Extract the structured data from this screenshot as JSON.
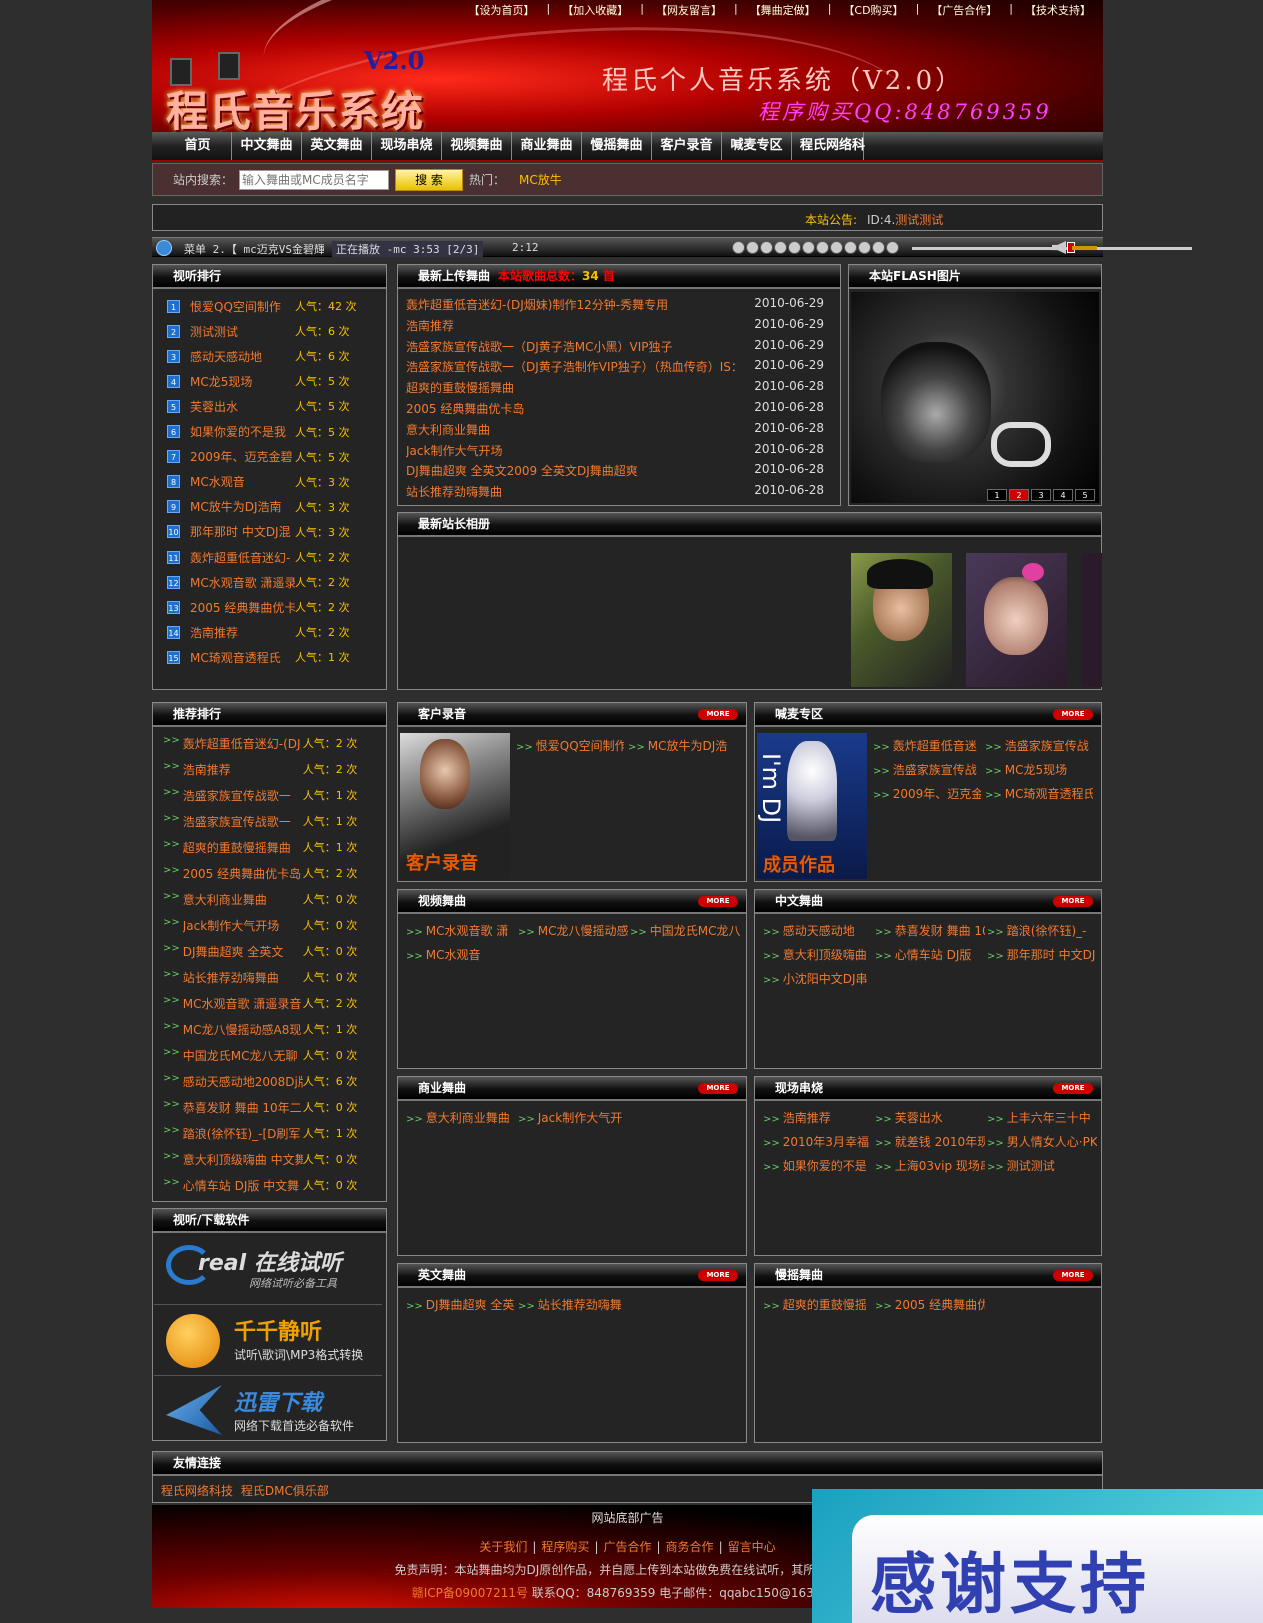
{
  "topbar": [
    "【设为首页】",
    "【加入收藏】",
    "【网友留言】",
    "【舞曲定做】",
    "【CD购买】",
    "【广告合作】",
    "【技术支持】"
  ],
  "header": {
    "logo": "程氏音乐系统",
    "version": "V2.0",
    "slogan": "程氏个人音乐系统（V2.0）",
    "qq": "程序购买QQ:848769359"
  },
  "nav": [
    "首页",
    "中文舞曲",
    "英文舞曲",
    "现场串烧",
    "视频舞曲",
    "商业舞曲",
    "慢摇舞曲",
    "客户录音",
    "喊麦专区",
    "程氏网络科"
  ],
  "search": {
    "label": "站内搜索：",
    "placeholder": "输入舞曲或MC成员名字",
    "button": "搜 索",
    "hot_label": "热门：",
    "hot_value": "MC放牛"
  },
  "notice": {
    "label": "本站公告:",
    "id": "ID:4.",
    "text": "测试测试"
  },
  "player": {
    "menu": "菜单 2.【 mc迈克VS金碧輝",
    "status": "正在播放 -mc 3:53 [2/3]",
    "time": "2:12"
  },
  "listen_rank": {
    "title": "视听排行",
    "items": [
      {
        "num": "1",
        "name": "恨爱QQ空间制作",
        "pop": "人气：42 次"
      },
      {
        "num": "2",
        "name": "测试测试",
        "pop": "人气：6 次"
      },
      {
        "num": "3",
        "name": "感动天感动地",
        "pop": "人气：6 次"
      },
      {
        "num": "4",
        "name": "MC龙5现场",
        "pop": "人气：5 次"
      },
      {
        "num": "5",
        "name": "芙蓉出水",
        "pop": "人气：5 次"
      },
      {
        "num": "6",
        "name": "如果你爱的不是我",
        "pop": "人气：5 次"
      },
      {
        "num": "7",
        "name": "2009年、迈克金碧",
        "pop": "人气：5 次"
      },
      {
        "num": "8",
        "name": "MC水观音",
        "pop": "人气：3 次"
      },
      {
        "num": "9",
        "name": "MC放牛为DJ浩南",
        "pop": "人气：3 次"
      },
      {
        "num": "10",
        "name": "那年那时 中文DJ混",
        "pop": "人气：3 次"
      },
      {
        "num": "11",
        "name": "轰炸超重低音迷幻-",
        "pop": "人气：2 次"
      },
      {
        "num": "12",
        "name": "MC水观音歌 潇遥录",
        "pop": "人气：2 次"
      },
      {
        "num": "13",
        "name": "2005 经典舞曲优卡",
        "pop": "人气：2 次"
      },
      {
        "num": "14",
        "name": "浩南推荐",
        "pop": "人气：2 次"
      },
      {
        "num": "15",
        "name": "MC琦观音透程氏",
        "pop": "人气：1 次"
      }
    ]
  },
  "latest_upload": {
    "title": "最新上传舞曲",
    "total_label": "本站歌曲总数：",
    "total": "34",
    "unit": "首",
    "items": [
      {
        "name": "轰炸超重低音迷幻-(DJ烟妹)制作12分钟-秀舞专用",
        "date": "2010-06-29"
      },
      {
        "name": "浩南推荐",
        "date": "2010-06-29"
      },
      {
        "name": "浩盛家族宣传战歌一（DJ黄子浩MC小黑）VIP独子",
        "date": "2010-06-29"
      },
      {
        "name": "浩盛家族宣传战歌一（DJ黄子浩制作VIP独子）（热血传奇）IS：",
        "date": "2010-06-29"
      },
      {
        "name": "超爽的重鼓慢摇舞曲",
        "date": "2010-06-28"
      },
      {
        "name": "2005 经典舞曲优卡岛",
        "date": "2010-06-28"
      },
      {
        "name": "意大利商业舞曲",
        "date": "2010-06-28"
      },
      {
        "name": "Jack制作大气开场",
        "date": "2010-06-28"
      },
      {
        "name": "DJ舞曲超爽 全英文2009 全英文DJ舞曲超爽",
        "date": "2010-06-28"
      },
      {
        "name": "站长推荐劲嗨舞曲",
        "date": "2010-06-28"
      }
    ]
  },
  "flash": {
    "title": "本站FLASH图片",
    "pages": [
      "1",
      "2",
      "3",
      "4",
      "5"
    ]
  },
  "album": {
    "title": "最新站长相册"
  },
  "recommend": {
    "title": "推荐排行",
    "items": [
      {
        "name": "轰炸超重低音迷幻-(DJ",
        "pop": "人气：2 次"
      },
      {
        "name": "浩南推荐",
        "pop": "人气：2 次"
      },
      {
        "name": "浩盛家族宣传战歌一",
        "pop": "人气：1 次"
      },
      {
        "name": "浩盛家族宣传战歌一",
        "pop": "人气：1 次"
      },
      {
        "name": "超爽的重鼓慢摇舞曲",
        "pop": "人气：1 次"
      },
      {
        "name": "2005 经典舞曲优卡岛",
        "pop": "人气：2 次"
      },
      {
        "name": "意大利商业舞曲",
        "pop": "人气：0 次"
      },
      {
        "name": "Jack制作大气开场",
        "pop": "人气：0 次"
      },
      {
        "name": "DJ舞曲超爽 全英文",
        "pop": "人气：0 次"
      },
      {
        "name": "站长推荐劲嗨舞曲",
        "pop": "人气：0 次"
      },
      {
        "name": "MC水观音歌 潇遥录音",
        "pop": "人气：2 次"
      },
      {
        "name": "MC龙八慢摇动感A8现",
        "pop": "人气：1 次"
      },
      {
        "name": "中国龙氏MC龙八无聊",
        "pop": "人气：0 次"
      },
      {
        "name": "感动天感动地2008Dj版",
        "pop": "人气：6 次"
      },
      {
        "name": "恭喜发财 舞曲 10年二",
        "pop": "人气：0 次"
      },
      {
        "name": "踏浪(徐怀钰)_-[D刷军",
        "pop": "人气：1 次"
      },
      {
        "name": "意大利顶级嗨曲 中文舞",
        "pop": "人气：0 次"
      },
      {
        "name": "心情车站 DJ版 中文舞",
        "pop": "人气：0 次"
      }
    ]
  },
  "software": {
    "title": "视听/下载软件",
    "items": [
      {
        "name": "real 在线试听",
        "sub": "网络试听必备工具"
      },
      {
        "name": "千千静听",
        "sub": "试听\\歌词\\MP3格式转换"
      },
      {
        "name": "迅雷下载",
        "sub": "网络下载首选必备软件"
      }
    ]
  },
  "sections": [
    {
      "title": "客户录音",
      "img": "客户录音",
      "links": [
        "恨爱QQ空间制作",
        "MC放牛为DJ浩"
      ]
    },
    {
      "title": "喊麦专区",
      "img": "成员作品",
      "img_sub": "I'm DJ",
      "links": [
        "轰炸超重低音迷",
        "浩盛家族宣传战",
        "浩盛家族宣传战",
        "MC龙5现场",
        "2009年、迈克金",
        "MC琦观音透程氏"
      ]
    },
    {
      "title": "视频舞曲",
      "links": [
        "MC水观音歌 潇",
        "MC龙八慢摇动感",
        "中国龙氏MC龙八",
        "MC水观音"
      ]
    },
    {
      "title": "中文舞曲",
      "links": [
        "感动天感动地",
        "恭喜发财 舞曲 10",
        "踏浪(徐怀钰)_-",
        "意大利顶级嗨曲",
        "心情车站 DJ版",
        "那年那时 中文DJ",
        "小沈阳中文DJ串"
      ]
    },
    {
      "title": "商业舞曲",
      "links": [
        "意大利商业舞曲",
        "Jack制作大气开"
      ]
    },
    {
      "title": "现场串烧",
      "links": [
        "浩南推荐",
        "芙蓉出水",
        "上丰六年三十中",
        "2010年3月幸福",
        "就差钱 2010年现",
        "男人情女人心·PK",
        "如果你爱的不是",
        "上海03vip 现场串",
        "测试测试"
      ]
    },
    {
      "title": "英文舞曲",
      "links": [
        "DJ舞曲超爽 全英",
        "站长推荐劲嗨舞"
      ]
    },
    {
      "title": "慢摇舞曲",
      "links": [
        "超爽的重鼓慢摇",
        "2005 经典舞曲优"
      ]
    }
  ],
  "more_label": "MORE",
  "friend": {
    "title": "友情连接",
    "links": [
      "程氏网络科技",
      "程氏DMC俱乐部"
    ]
  },
  "footer": {
    "ad": "网站底部广告",
    "links": [
      "关于我们",
      "程序购买",
      "广告合作",
      "商务合作",
      "留言中心"
    ],
    "declaration": "免责声明：本站舞曲均为DJ原创作品，并自愿上传到本站做免费在线试听，其所有权为D",
    "icp": "赣ICP备09007211号",
    "contact": "联系QQ：848769359 电子邮件：qqabc150@163.com"
  },
  "overlay": {
    "text": "感谢支持"
  }
}
